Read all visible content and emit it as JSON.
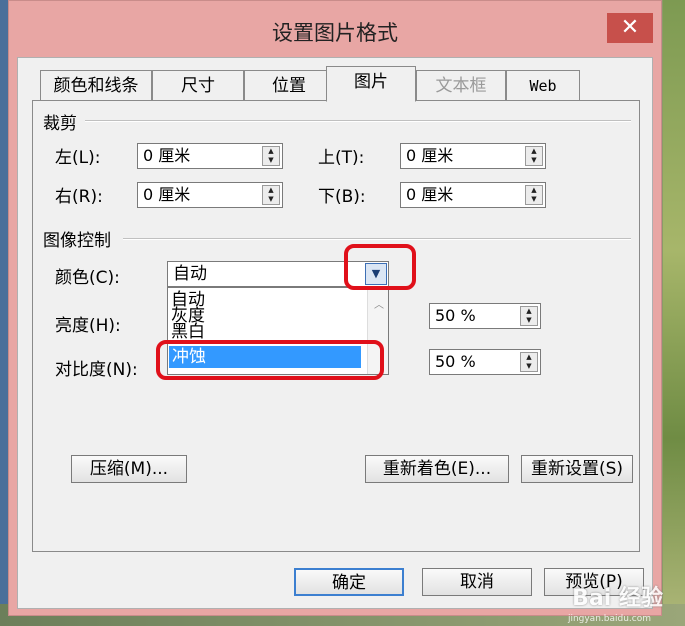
{
  "window": {
    "title": "设置图片格式",
    "close_glyph": "✕"
  },
  "tabs": [
    {
      "label": "颜色和线条",
      "state": "normal"
    },
    {
      "label": "尺寸",
      "state": "normal"
    },
    {
      "label": "位置",
      "state": "normal"
    },
    {
      "label": "图片",
      "state": "active"
    },
    {
      "label": "文本框",
      "state": "disabled"
    },
    {
      "label": "Web",
      "state": "normal"
    }
  ],
  "crop": {
    "section_label": "裁剪",
    "left": {
      "label": "左(L):",
      "value": "0 厘米"
    },
    "top": {
      "label": "上(T):",
      "value": "0 厘米"
    },
    "right": {
      "label": "右(R):",
      "value": "0 厘米"
    },
    "bottom": {
      "label": "下(B):",
      "value": "0 厘米"
    }
  },
  "image_control": {
    "section_label": "图像控制",
    "color": {
      "label": "颜色(C):",
      "value": "自动",
      "options": [
        "自动",
        "灰度",
        "黑白",
        "冲蚀"
      ],
      "highlighted": "冲蚀"
    },
    "brightness": {
      "label": "亮度(H):",
      "value": "50 %"
    },
    "contrast": {
      "label": "对比度(N):",
      "value": "50 %"
    }
  },
  "buttons": {
    "compress": "压缩(M)...",
    "recolor": "重新着色(E)...",
    "reset": "重新设置(S)",
    "ok": "确定",
    "cancel": "取消",
    "preview": "预览(P)"
  },
  "watermark": {
    "text": "Bai 经验",
    "sub": "jingyan.baidu.com"
  },
  "colors": {
    "titlebar": "#e8a6a4",
    "close": "#c7504b",
    "annotation": "#e0101a",
    "selection": "#3399ff"
  }
}
